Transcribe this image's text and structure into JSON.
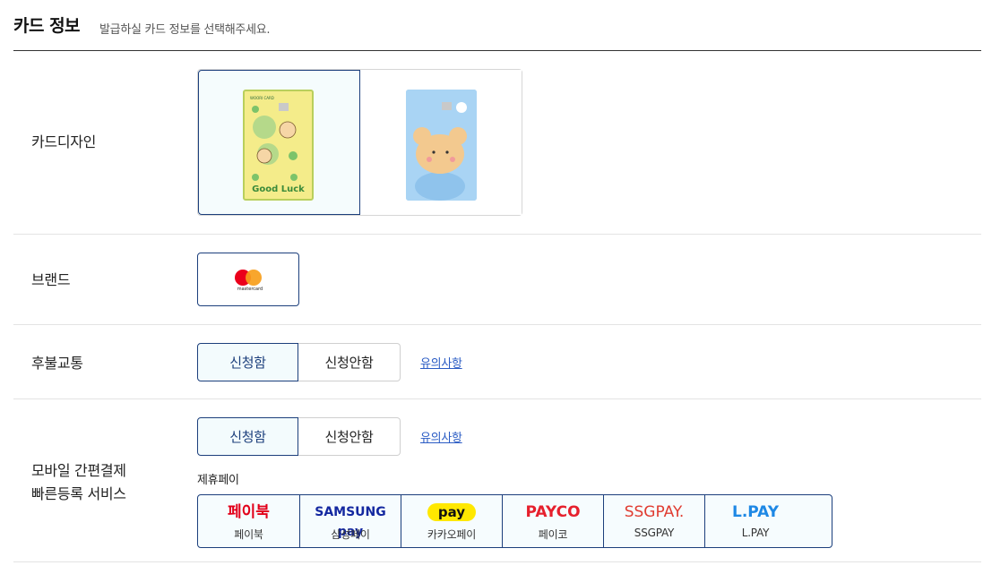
{
  "header": {
    "title": "카드 정보",
    "subtitle": "발급하실 카드 정보를 선택해주세요."
  },
  "rows": {
    "design": {
      "label": "카드디자인",
      "options": [
        {
          "name": "card-design-1",
          "selected": true,
          "card_text": "Good Luck"
        },
        {
          "name": "card-design-2",
          "selected": false
        }
      ]
    },
    "brand": {
      "label": "브랜드",
      "logo_text": "mastercard"
    },
    "transit": {
      "label": "후불교통",
      "options": [
        "신청함",
        "신청안함"
      ],
      "selected": "신청함",
      "notice": "유의사항"
    },
    "mobile_pay": {
      "label_line1": "모바일 간편결제",
      "label_line2": "빠른등록 서비스",
      "options": [
        "신청함",
        "신청안함"
      ],
      "selected": "신청함",
      "notice": "유의사항",
      "caption": "제휴페이",
      "pays": [
        {
          "logo": "페이북",
          "name": "페이북",
          "color": "#e2001a"
        },
        {
          "logo": "SAMSUNG pay",
          "name": "삼성페이",
          "color": "#1428a0"
        },
        {
          "logo": "pay",
          "name": "카카오페이",
          "color": "#111111"
        },
        {
          "logo": "PAYCO",
          "name": "페이코",
          "color": "#e6202d"
        },
        {
          "logo": "SSGPAY.",
          "name": "SSGPAY",
          "color": "#e03c31"
        },
        {
          "logo": "L.PAY",
          "name": "L.PAY",
          "color": "#1e88e5"
        }
      ]
    }
  },
  "colors": {
    "accent": "#1c3f7c",
    "link": "#2b5cc4",
    "selected_bg": "#f3fbfd"
  }
}
